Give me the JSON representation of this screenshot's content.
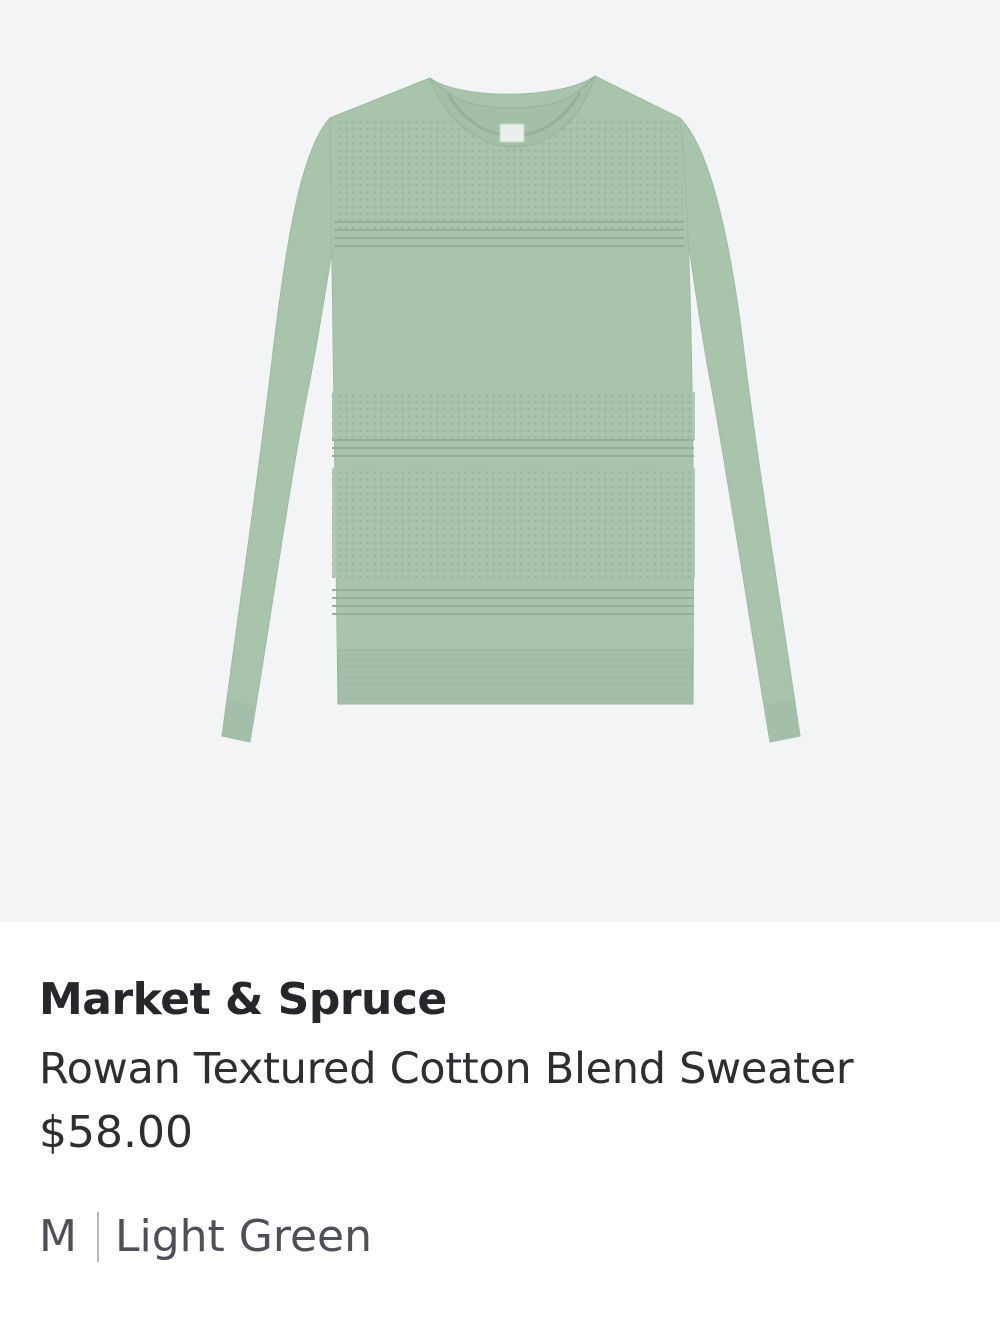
{
  "product": {
    "brand": "Market & Spruce",
    "name": "Rowan Textured Cotton Blend Sweater",
    "price": "$58.00",
    "size": "M",
    "color": "Light Green"
  },
  "image": {
    "description_icon": "sweater-image",
    "garment_color": "#a9c4ad",
    "background_color": "#f3f4f6"
  }
}
